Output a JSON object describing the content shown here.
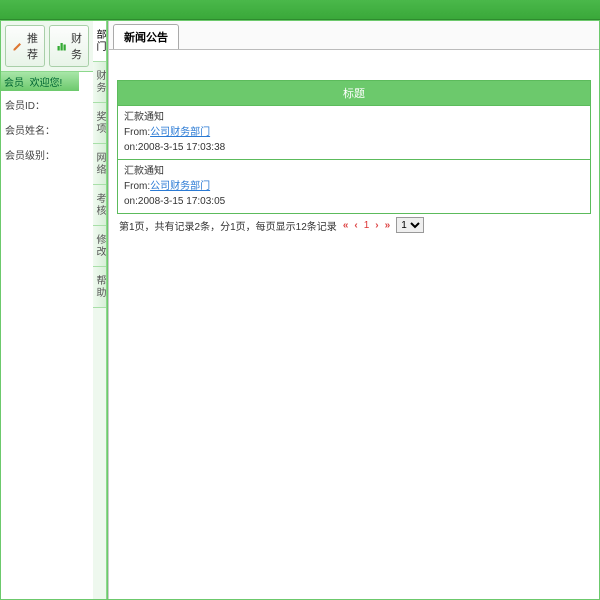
{
  "toolbar": {
    "recommend_label": "推荐",
    "finance_label": "财务"
  },
  "sidebar": {
    "header_role": "会员",
    "header_welcome": "欢迎您!",
    "rows": [
      {
        "label": "会员ID：",
        "value": ""
      },
      {
        "label": "会员姓名：",
        "value": ""
      },
      {
        "label": "会员级别：",
        "value": ""
      }
    ],
    "vtabs": [
      "部门",
      "财务",
      "奖项",
      "网络",
      "考核",
      "修改",
      "帮助"
    ]
  },
  "main": {
    "tab_label": "新闻公告",
    "table": {
      "header": "标题",
      "rows": [
        {
          "title": "汇款通知",
          "from_prefix": "From:",
          "from_link": "公司财务部门",
          "time_prefix": "on:",
          "time": "2008-3-15 17:03:38"
        },
        {
          "title": "汇款通知",
          "from_prefix": "From:",
          "from_link": "公司财务部门",
          "time_prefix": "on:",
          "time": "2008-3-15 17:03:05"
        }
      ]
    },
    "pager": {
      "summary": "第1页，共有记录2条，分1页，每页显示12条记录",
      "current": "1",
      "select_value": "1"
    }
  }
}
